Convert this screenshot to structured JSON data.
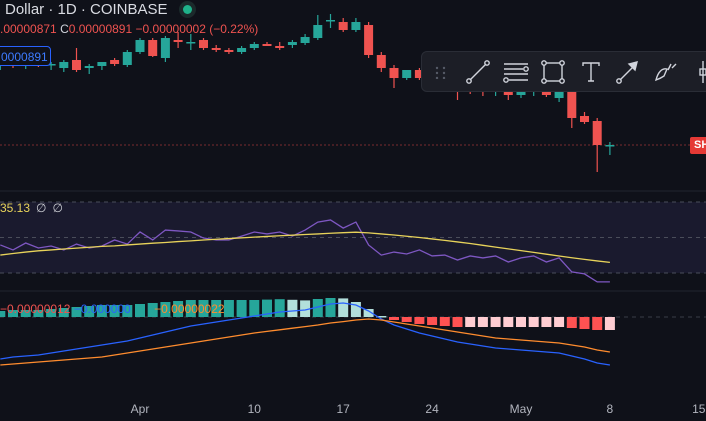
{
  "header": {
    "title": "Dollar · 1D · COINBASE",
    "ohlc_low": ".00000871",
    "close_prefix": "C",
    "close": "0.00000891",
    "change": "−0.00000002 (−0.22%)",
    "status_color": "#1fb28a"
  },
  "price_badge": "0000891",
  "last_price_label": "SH",
  "rsi_legend": {
    "value": "35.13",
    "extra1": "∅",
    "extra2": "∅"
  },
  "macd_legend": {
    "macd": "−0.00000012",
    "signal": "−0.000000",
    "hist": "−0.00000022"
  },
  "toolbar": {
    "icons": [
      "drag-handle-icon",
      "trend-line-icon",
      "fib-lines-icon",
      "rectangle-icon",
      "text-icon",
      "arrow-icon",
      "brush-icon",
      "measure-icon"
    ]
  },
  "colors": {
    "up": "#26a69a",
    "down": "#ef5350",
    "rsi": "#7e57c2",
    "rsi_ma": "#e8d35a",
    "macd": "#2962ff",
    "signal": "#ff8c2e"
  },
  "chart_data": {
    "type": "candlestick",
    "x_ticks": [
      {
        "label": "Apr",
        "day": 0
      },
      {
        "label": "10",
        "day": 9
      },
      {
        "label": "17",
        "day": 16
      },
      {
        "label": "24",
        "day": 23
      },
      {
        "label": "May",
        "day": 30
      },
      {
        "label": "8",
        "day": 37
      },
      {
        "label": "15",
        "day": 44
      }
    ],
    "start_day": -11,
    "price_units": "relative",
    "candles": [
      [
        136,
        140,
        130,
        138
      ],
      [
        138,
        141,
        132,
        134
      ],
      [
        134,
        139,
        131,
        137
      ],
      [
        137,
        140,
        133,
        135
      ],
      [
        135,
        138,
        130,
        136
      ],
      [
        132,
        140,
        128,
        138
      ],
      [
        140,
        152,
        128,
        130
      ],
      [
        132,
        136,
        126,
        134
      ],
      [
        134,
        138,
        130,
        138
      ],
      [
        140,
        142,
        134,
        136
      ],
      [
        135,
        150,
        133,
        148
      ],
      [
        148,
        162,
        146,
        160
      ],
      [
        160,
        162,
        143,
        144
      ],
      [
        142,
        164,
        138,
        162
      ],
      [
        160,
        168,
        152,
        158
      ],
      [
        158,
        166,
        150,
        158
      ],
      [
        160,
        162,
        150,
        152
      ],
      [
        152,
        155,
        148,
        150
      ],
      [
        150,
        152,
        146,
        148
      ],
      [
        148,
        154,
        146,
        152
      ],
      [
        152,
        158,
        150,
        156
      ],
      [
        156,
        158,
        154,
        154
      ],
      [
        154,
        158,
        150,
        152
      ],
      [
        155,
        160,
        152,
        158
      ],
      [
        157,
        166,
        155,
        163
      ],
      [
        162,
        185,
        160,
        175
      ],
      [
        180,
        186,
        172,
        180
      ],
      [
        178,
        182,
        168,
        170
      ],
      [
        170,
        182,
        168,
        178
      ],
      [
        175,
        178,
        142,
        145
      ],
      [
        145,
        148,
        128,
        132
      ],
      [
        132,
        135,
        112,
        122
      ],
      [
        122,
        130,
        120,
        130
      ],
      [
        130,
        132,
        120,
        122
      ],
      [
        122,
        126,
        116,
        120
      ],
      [
        120,
        124,
        114,
        118
      ],
      [
        118,
        120,
        100,
        112
      ],
      [
        112,
        118,
        106,
        110
      ],
      [
        110,
        114,
        104,
        108
      ],
      [
        108,
        112,
        104,
        110
      ],
      [
        110,
        112,
        100,
        105
      ],
      [
        105,
        112,
        102,
        110
      ],
      [
        108,
        112,
        104,
        110
      ],
      [
        110,
        112,
        103,
        105
      ],
      [
        102,
        110,
        98,
        109
      ],
      [
        108,
        110,
        72,
        82
      ],
      [
        84,
        88,
        76,
        78
      ],
      [
        79,
        82,
        28,
        55
      ],
      [
        55,
        58,
        45,
        55
      ]
    ],
    "rsi": [
      45.8,
      43,
      46.9,
      44.1,
      45.2,
      43,
      46.3,
      44.1,
      45.2,
      48.6,
      46.3,
      53.1,
      48.6,
      54.2,
      53.7,
      53.1,
      49.7,
      48.6,
      48.6,
      50.8,
      53.1,
      52,
      53.1,
      50.8,
      54.2,
      58.7,
      59.9,
      55.3,
      58.7,
      45.8,
      40.1,
      41.8,
      40.7,
      43,
      39.6,
      40.1,
      37.3,
      39.6,
      38.5,
      39.6,
      36.2,
      38.5,
      39.6,
      36.2,
      38.5,
      30.6,
      29.5,
      25,
      25
    ],
    "rsi_ma": [
      40.1,
      41,
      41.8,
      42.5,
      43,
      43.5,
      44,
      44.5,
      45,
      45.3,
      45.8,
      46.3,
      46.8,
      47.2,
      47.7,
      48.1,
      48.6,
      49,
      49.4,
      49.8,
      50.2,
      50.6,
      51,
      51.3,
      51.7,
      52,
      52.4,
      52.7,
      53,
      52.6,
      52,
      51.4,
      50.7,
      50,
      49.2,
      48.4,
      47.5,
      46.6,
      45.6,
      44.6,
      43.6,
      42.6,
      41.6,
      40.6,
      39.6,
      38.6,
      37.7,
      36.8,
      36
    ],
    "rsi_levels": [
      70,
      50,
      30
    ],
    "macd": [
      -21,
      -20,
      -19.5,
      -19,
      -18,
      -17,
      -16,
      -15,
      -14,
      -13,
      -12,
      -10.5,
      -9,
      -7.5,
      -6,
      -4.5,
      -3.5,
      -2.5,
      -1.5,
      -0.5,
      0.5,
      1.5,
      2.5,
      3,
      3.5,
      5,
      6.5,
      7,
      6,
      3,
      -1,
      -4,
      -6,
      -8,
      -9.5,
      -11,
      -12.5,
      -13.5,
      -14.5,
      -15.5,
      -16,
      -16.5,
      -17,
      -17.5,
      -18,
      -19.5,
      -21,
      -23,
      -24
    ],
    "signal": [
      -24,
      -23.5,
      -23,
      -22.5,
      -22,
      -21.5,
      -21,
      -20.5,
      -20,
      -19,
      -18,
      -17,
      -16,
      -15,
      -14,
      -13,
      -12,
      -11,
      -10,
      -9,
      -8,
      -7.2,
      -6.4,
      -5.6,
      -4.8,
      -4,
      -3,
      -2.3,
      -1.5,
      -1,
      -1.5,
      -2.5,
      -3.5,
      -4.5,
      -5.5,
      -6.5,
      -7.5,
      -8.5,
      -9.5,
      -10.5,
      -11,
      -11.5,
      -12,
      -12.5,
      -13,
      -14,
      -15,
      -16.5,
      -17.5
    ]
  }
}
